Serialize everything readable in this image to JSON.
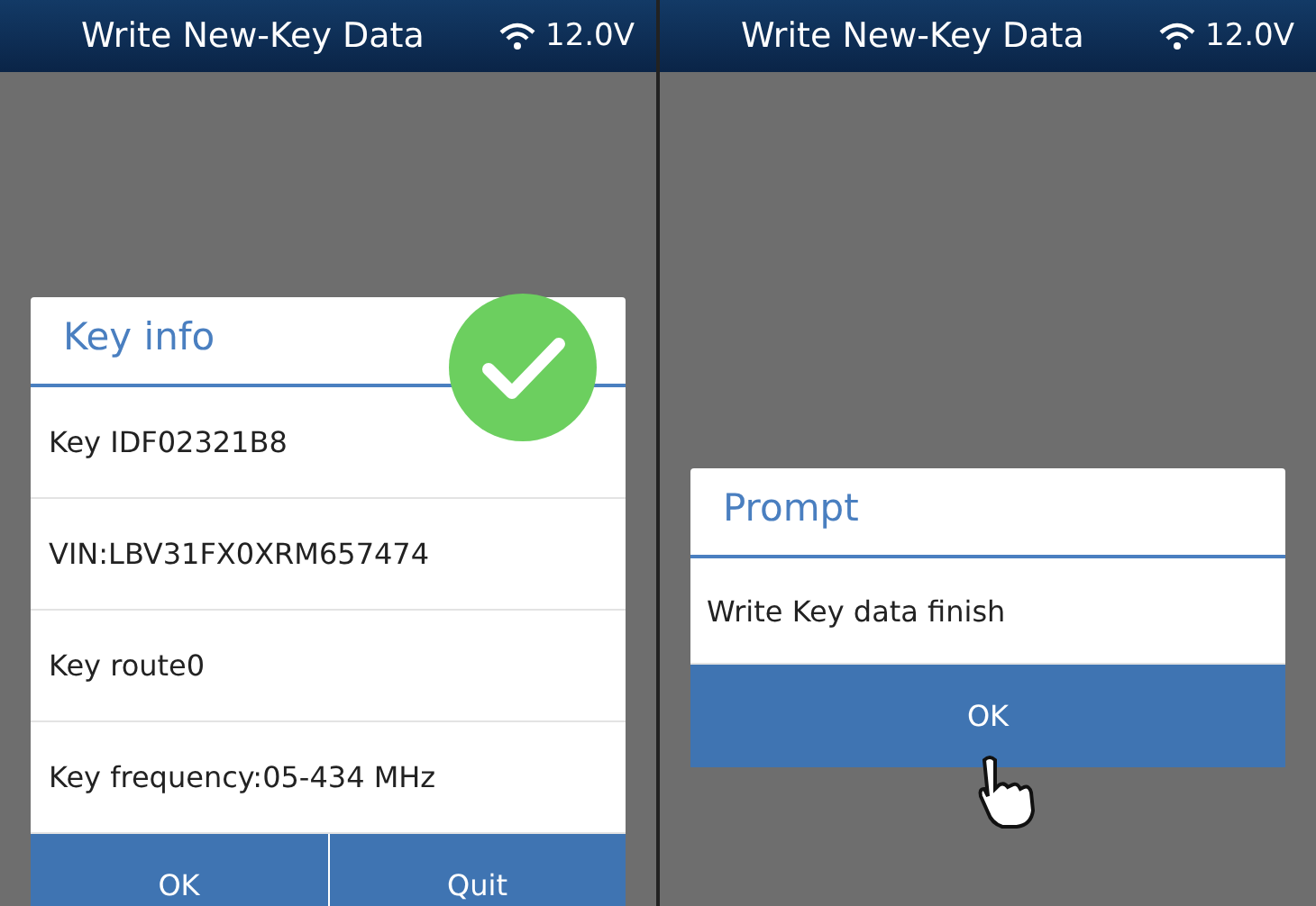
{
  "screens": [
    {
      "header": {
        "title": "Write New-Key Data",
        "voltage": "12.0V"
      },
      "dialog": {
        "kind": "list",
        "title": "Key info",
        "confirmed": true,
        "rows": [
          "Key IDF02321B8",
          "VIN:LBV31FX0XRM657474",
          "Key route0",
          "Key frequency:05-434 MHz"
        ],
        "buttons": [
          "OK",
          "Quit"
        ]
      },
      "pointer": false
    },
    {
      "header": {
        "title": "Write New-Key Data",
        "voltage": "12.0V"
      },
      "dialog": {
        "kind": "message",
        "title": "Prompt",
        "confirmed": false,
        "rows": [
          "Write Key data finish"
        ],
        "buttons": [
          "OK"
        ]
      },
      "pointer": true
    }
  ]
}
